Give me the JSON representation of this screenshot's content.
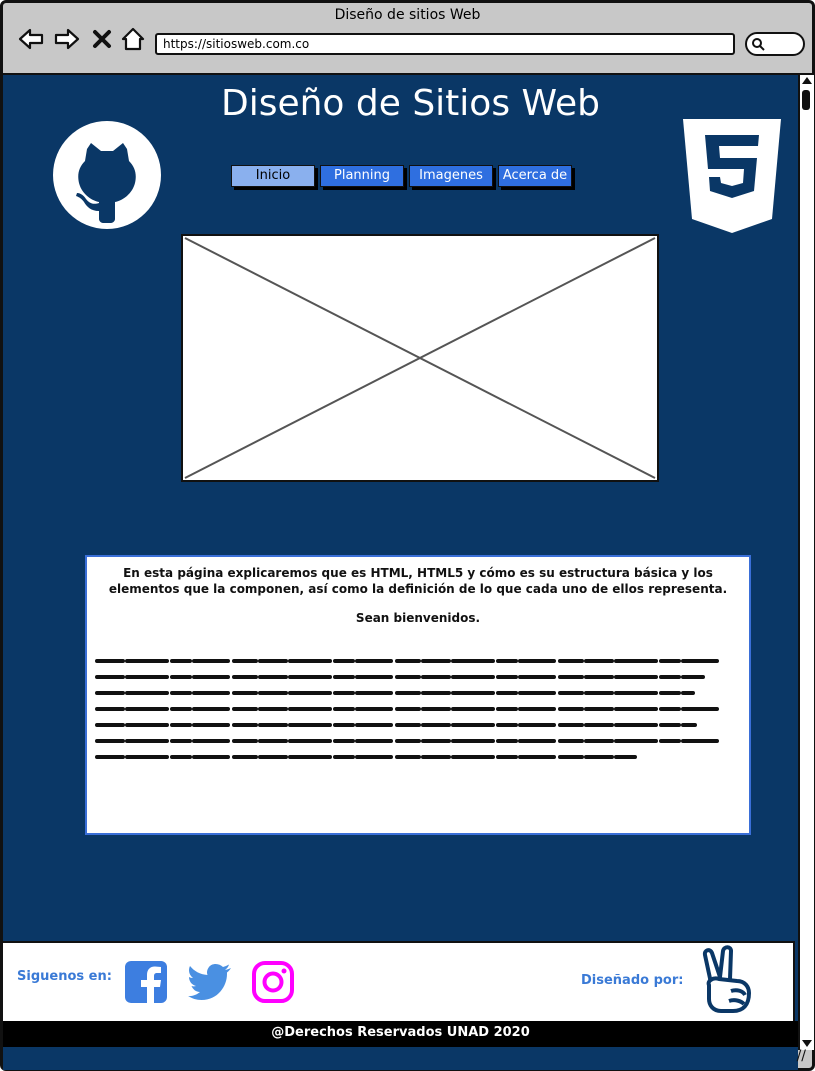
{
  "browser": {
    "window_title": "Diseño de sitios Web",
    "url": "https://sitiosweb.com.co"
  },
  "page": {
    "title": "Diseño de Sitios Web",
    "nav": [
      {
        "label": "Inicio",
        "active": true
      },
      {
        "label": "Planning",
        "active": false
      },
      {
        "label": "Imagenes",
        "active": false
      },
      {
        "label": "Acerca de",
        "active": false
      }
    ],
    "intro": "En esta página explicaremos que es HTML, HTML5 y cómo es su estructura básica y los elementos que la componen, así como la definición de lo que cada uno de ellos representa.",
    "welcome": "Sean bienvenidos."
  },
  "footer": {
    "follow_label": "Siguenos en:",
    "designed_by_label": "Diseñado por:",
    "social_icons": [
      "facebook-icon",
      "twitter-icon",
      "instagram-icon"
    ],
    "copyright": "@Derechos Reservados UNAD 2020"
  },
  "colors": {
    "page_bg": "#0a3766",
    "nav_button": "#2f6fe0",
    "nav_active": "#8ab0ee",
    "accent_text": "#3a7ad6",
    "instagram": "#ff00ff",
    "facebook": "#3d7ee0",
    "twitter": "#4a90e2"
  }
}
